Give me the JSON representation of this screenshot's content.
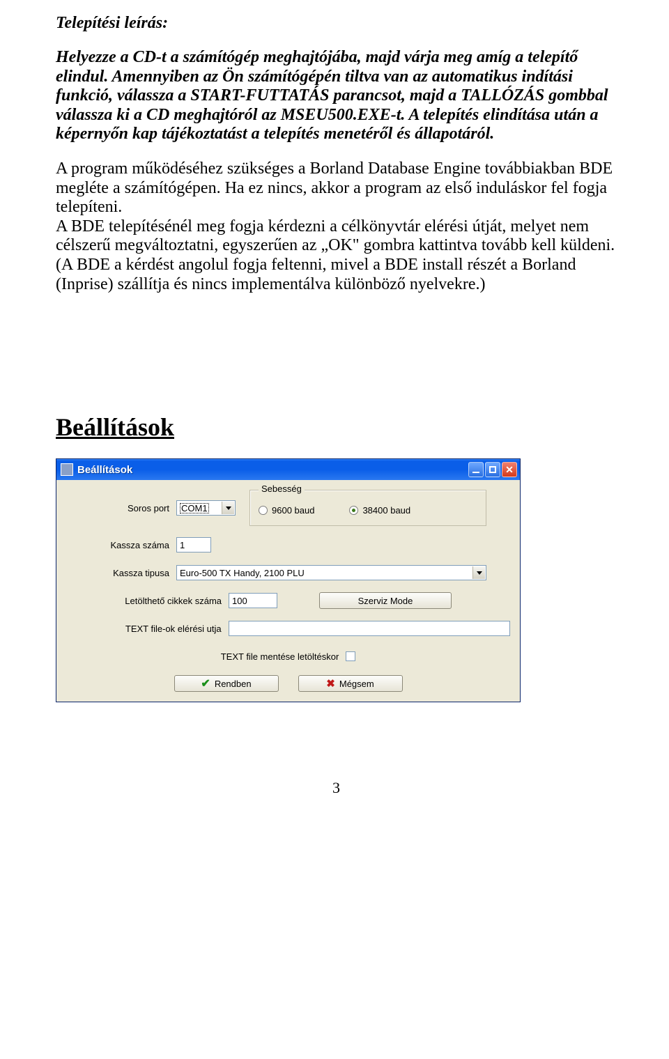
{
  "doc": {
    "title": "Telepítési leírás:",
    "para1": "Helyezze a CD-t a számítógép meghajtójába, majd várja meg amíg a telepítő elindul. Amennyiben az Ön számítógépén tiltva van az automatikus indítási funkció, válassza a START-FUTTATÁS parancsot, majd a TALLÓZÁS gombbal válassza ki a CD meghajtóról az MSEU500.EXE-t. A telepítés elindítása után a képernyőn kap tájékoztatást a telepítés menetéről és állapotáról.",
    "para2": "A program működéséhez szükséges a Borland Database Engine továbbiakban BDE megléte a számítógépen. Ha ez nincs, akkor a program az első induláskor fel fogja telepíteni.\nA BDE telepítésénél meg fogja kérdezni a célkönyvtár elérési útját, melyet nem célszerű megváltoztatni, egyszerűen az „OK\" gombra kattintva tovább kell küldeni. (A BDE a kérdést angolul fogja feltenni, mivel a BDE install részét a Borland (Inprise) szállítja és nincs implementálva különböző nyelvekre.)",
    "section": "Beállítások",
    "pagenum": "3"
  },
  "dialog": {
    "title": "Beállítások",
    "labels": {
      "soros_port": "Soros port",
      "kassza_szama": "Kassza száma",
      "kassza_tipusa": "Kassza tipusa",
      "letoltheto": "Letölthető cikkek száma",
      "text_path": "TEXT file-ok elérési utja",
      "text_save": "TEXT file mentése letöltéskor"
    },
    "values": {
      "soros_port": "COM1",
      "kassza_szama": "1",
      "kassza_tipusa": "Euro-500 TX Handy, 2100 PLU",
      "letoltheto": "100",
      "text_path": ""
    },
    "speed": {
      "legend": "Sebesség",
      "opt1": "9600 baud",
      "opt2": "38400 baud",
      "selected": "opt2"
    },
    "buttons": {
      "szerviz": "Szerviz Mode",
      "ok": "Rendben",
      "cancel": "Mégsem"
    }
  }
}
